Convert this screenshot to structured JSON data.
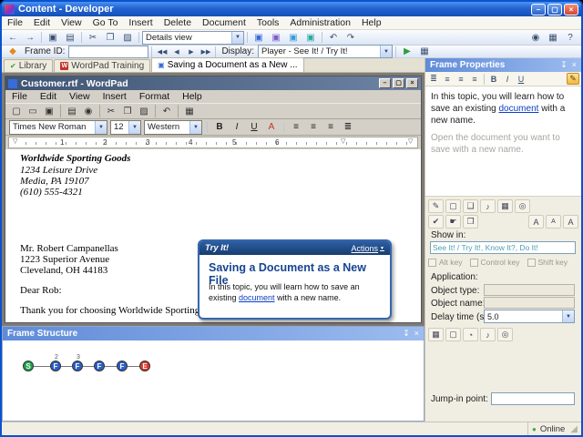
{
  "colors": {
    "titlebar_blue": "#2263D2",
    "link_blue": "#0B3FC4",
    "heading_blue": "#17458F",
    "node_start_green": "#1FA34A",
    "node_frame_blue": "#2B5FC7",
    "node_end_red": "#D8372B",
    "online_green": "#44AA44",
    "show_in_teal": "#4AA0B5"
  },
  "titlebar": {
    "title": "Content - Developer"
  },
  "menubar": {
    "items": [
      "File",
      "Edit",
      "View",
      "Go To",
      "Insert",
      "Delete",
      "Document",
      "Tools",
      "Administration",
      "Help"
    ]
  },
  "toolbar_main": {
    "details_view_value": "Details view"
  },
  "toolbar_frame": {
    "frame_id_label": "Frame ID:",
    "frame_id_value": "",
    "display_label": "Display:",
    "display_value": "Player - See It! / Try It!"
  },
  "tabs": {
    "tab1": "Library",
    "tab2": "WordPad Training",
    "tab3": "Saving a Document as a New ..."
  },
  "wordpad": {
    "title": "Customer.rtf - WordPad",
    "menu": [
      "File",
      "Edit",
      "View",
      "Insert",
      "Format",
      "Help"
    ],
    "font_name": "Times New Roman",
    "font_size": "12",
    "charset": "Western",
    "ruler_numbers": [
      "1",
      "2",
      "3",
      "4",
      "5",
      "6"
    ],
    "document": {
      "company": "Worldwide Sporting Goods",
      "company_addr1": "1234 Leisure Drive",
      "company_addr2": "Media, PA 19107",
      "company_phone": "(610) 555-4321",
      "recipient_name": "Mr. Robert Campanellas",
      "recipient_addr1": "1223 Superior Avenue",
      "recipient_addr2": "Cleveland, OH 44183",
      "salutation": "Dear Rob:",
      "body_line": "Thank you for choosing Worldwide Sporting Goods"
    }
  },
  "tryit": {
    "title": "Try It!",
    "actions": "Actions",
    "heading": "Saving a Document as a New File",
    "body_before": "In this topic, you will learn how to save an existing ",
    "body_link": "document",
    "body_after": " with a new name."
  },
  "frame_properties": {
    "title": "Frame Properties",
    "bubble_p1_before": "In this topic, you will learn how to save an existing ",
    "bubble_p1_link": "document",
    "bubble_p1_after": " with a new name.",
    "bubble_p2": "Open the document you want to save with a new name.",
    "show_in_label": "Show in:",
    "show_in_value": "See It! / Try It!, Know It?, Do It!",
    "alt_key": "Alt key",
    "control_key": "Control key",
    "shift_key": "Shift key",
    "application_label": "Application:",
    "object_type_label": "Object type:",
    "object_type_value": "",
    "object_name_label": "Object name:",
    "object_name_value": "",
    "delay_label": "Delay time (s):",
    "delay_value": "5.0",
    "jump_in_label": "Jump-in point:",
    "jump_in_value": ""
  },
  "frame_structure": {
    "title": "Frame Structure",
    "nodes": [
      {
        "label": "S",
        "num": ""
      },
      {
        "label": "F",
        "num": "2"
      },
      {
        "label": "F",
        "num": "3"
      },
      {
        "label": "F",
        "num": ""
      },
      {
        "label": "F",
        "num": ""
      },
      {
        "label": "E",
        "num": ""
      }
    ]
  },
  "statusbar": {
    "online": "Online"
  },
  "glyphs": {
    "minimize": "–",
    "maximize": "▢",
    "close": "×",
    "back": "←",
    "forward": "→",
    "save": "▣",
    "print": "▤",
    "cut": "✂",
    "copy": "❐",
    "paste": "▨",
    "undo": "↶",
    "redo": "↷",
    "find": "◉",
    "grid": "▦",
    "help": "?",
    "dropdown": "▼",
    "frame_diamond": "◆",
    "first": "◀◀",
    "prev": "◀",
    "next": "▶",
    "last": "▶▶",
    "play": "▶",
    "check": "✔",
    "pin": "↧",
    "align": "≡",
    "align_list": "≣",
    "bold": "B",
    "italic": "I",
    "underline": "U",
    "letter_a": "A",
    "new_doc": "▢",
    "open_doc": "▭",
    "date": "▦",
    "pencil": "✎",
    "bubble": "❑",
    "sound": "♪",
    "target": "◎",
    "hand": "☛",
    "clock": "◔",
    "mode_box": "▣",
    "w_letter": "W",
    "online_dot": "●",
    "grip": "◢",
    "ruler_marker": "▽"
  }
}
